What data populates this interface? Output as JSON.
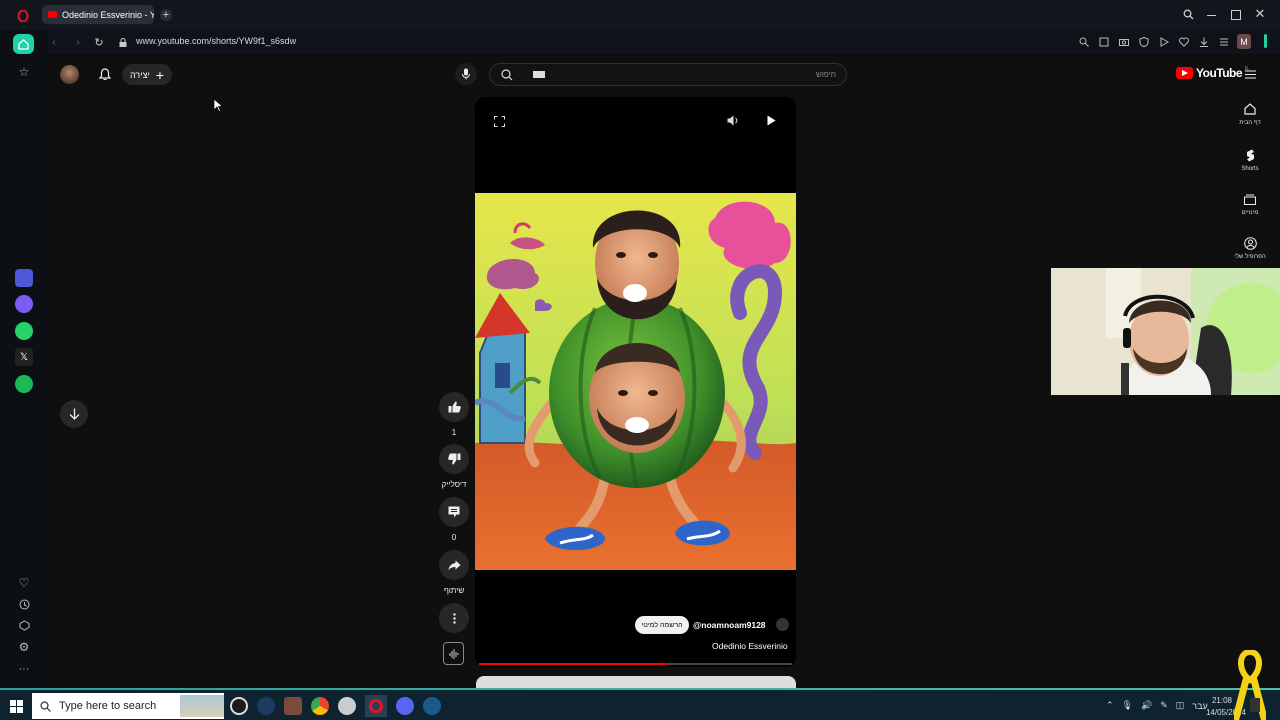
{
  "browser": {
    "tab_title": "Odedinio Essverinio - You",
    "url": "www.youtube.com/shorts/YW9f1_s6sdw",
    "profile_letter": "M"
  },
  "youtube": {
    "logo_text": "YouTube",
    "logo_superscript": "IL",
    "search_placeholder": "חיפוש",
    "create_label": "יצירה",
    "nav": [
      {
        "label": "דף הבית",
        "icon": "home-icon"
      },
      {
        "label": "Shorts",
        "icon": "shorts-icon"
      },
      {
        "label": "מינויים",
        "icon": "subscriptions-icon"
      },
      {
        "label": "הפרופיל שלי",
        "icon": "profile-icon"
      }
    ]
  },
  "short": {
    "likes": "1",
    "dislike_label": "דיסלייק",
    "comments": "0",
    "share_label": "שיתוף",
    "channel_handle": "@noamnoam9128",
    "subscribe_label": "הרשמה למינוי",
    "title": "Odedinio Essverinio",
    "progress": 0.6
  },
  "taskbar": {
    "search_placeholder": "Type here to search",
    "time": "21:08",
    "date": "14/05/2024",
    "language": "עבר"
  },
  "colors": {
    "accent_red": "#ff0000",
    "opera_red": "#e0132b",
    "sidebar_green": "#1fd1a5"
  }
}
